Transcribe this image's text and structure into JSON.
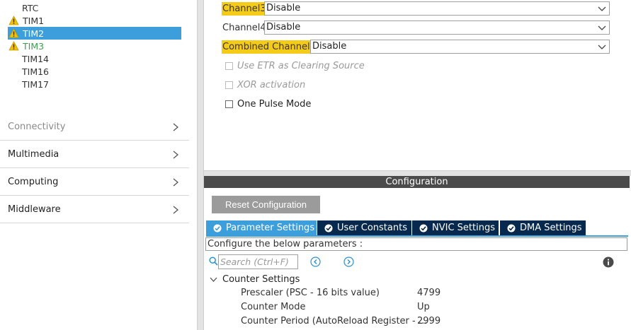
{
  "tree": {
    "items": [
      {
        "label": "RTC",
        "warning": false
      },
      {
        "label": "TIM1",
        "warning": true
      },
      {
        "label": "TIM2",
        "warning": true
      },
      {
        "label": "TIM3",
        "warning": true
      },
      {
        "label": "TIM14",
        "warning": false
      },
      {
        "label": "TIM16",
        "warning": false
      },
      {
        "label": "TIM17",
        "warning": false
      }
    ],
    "selected": "TIM2"
  },
  "categories": [
    {
      "label": "Connectivity"
    },
    {
      "label": "Multimedia"
    },
    {
      "label": "Computing"
    },
    {
      "label": "Middleware"
    }
  ],
  "mode": {
    "channel3": {
      "label": "Channel3",
      "value": "Disable"
    },
    "channel4": {
      "label": "Channel4",
      "value": "Disable"
    },
    "combined": {
      "label": "Combined Channels",
      "value": "Disable"
    },
    "checkboxes": [
      {
        "label": "Use ETR as Clearing Source",
        "checked": false,
        "enabled": false
      },
      {
        "label": "XOR activation",
        "checked": false,
        "enabled": false
      },
      {
        "label": "One Pulse Mode",
        "checked": false,
        "enabled": true
      }
    ]
  },
  "config": {
    "header": "Configuration",
    "reset_label": "Reset Configuration",
    "tabs": [
      {
        "label": "Parameter Settings",
        "active": true
      },
      {
        "label": "User Constants",
        "active": false
      },
      {
        "label": "NVIC Settings",
        "active": false
      },
      {
        "label": "DMA Settings",
        "active": false
      }
    ],
    "description": "Configure the below parameters :",
    "search_placeholder": "Search (Ctrl+F)",
    "group_label": "Counter Settings",
    "params": [
      {
        "name": "Prescaler (PSC - 16 bits value)",
        "value": "4799"
      },
      {
        "name": "Counter Mode",
        "value": "Up"
      },
      {
        "name": "Counter Period (AutoReload Register - ...",
        "value": "2999"
      }
    ]
  },
  "colors": {
    "selection": "#3c9fdb",
    "highlight": "#f5cb1a",
    "tab_dark": "#08294e",
    "header_bar": "#4b4b4b",
    "warning": "#f2c200",
    "ok_green": "#3aa24d"
  }
}
